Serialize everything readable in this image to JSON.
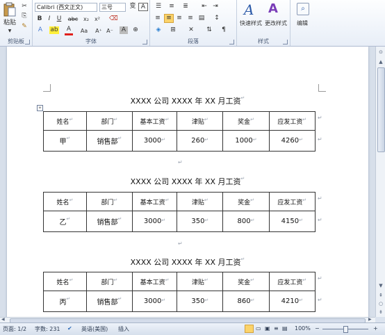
{
  "ribbon": {
    "clipboard": {
      "paste_label": "粘贴",
      "group_label": "剪贴板"
    },
    "font": {
      "font_name": "Calibri (西文正文)",
      "font_size": "三号",
      "phonetic": "变",
      "border_char": "A",
      "bold": "B",
      "italic": "I",
      "underline": "U",
      "strikethrough": "abc",
      "subscript": "x₂",
      "superscript": "x²",
      "font_color": "A",
      "change_case": "Aa",
      "grow": "A⁺",
      "shrink": "A⁻",
      "char_border": "A",
      "enclose": "⊕",
      "group_label": "字体"
    },
    "paragraph": {
      "group_label": "段落"
    },
    "styles": {
      "quick_styles_label": "快速样式",
      "change_styles_label": "更改样式",
      "group_label": "样式"
    },
    "editing": {
      "label": "编辑"
    }
  },
  "document": {
    "tables": [
      {
        "title": "XXXX 公司 XXXX 年 XX 月工资",
        "headers": [
          "姓名",
          "部门",
          "基本工资",
          "津贴",
          "奖金",
          "应发工资"
        ],
        "row": [
          "甲",
          "销售部",
          "3000",
          "260",
          "1000",
          "4260"
        ]
      },
      {
        "title": "XXXX 公司 XXXX 年 XX 月工资",
        "headers": [
          "姓名",
          "部门",
          "基本工资",
          "津贴",
          "奖金",
          "应发工资"
        ],
        "row": [
          "乙",
          "销售部",
          "3000",
          "350",
          "800",
          "4150"
        ]
      },
      {
        "title": "XXXX 公司 XXXX 年 XX 月工资",
        "headers": [
          "姓名",
          "部门",
          "基本工资",
          "津贴",
          "奖金",
          "应发工资"
        ],
        "row": [
          "丙",
          "销售部",
          "3000",
          "350",
          "860",
          "4210"
        ]
      }
    ],
    "mark": "↵"
  },
  "status": {
    "page": "页面: 1/2",
    "words": "字数: 231",
    "language": "英语(美国)",
    "insert_mode": "插入",
    "zoom": "100%",
    "zoom_out": "−",
    "zoom_in": "+"
  }
}
